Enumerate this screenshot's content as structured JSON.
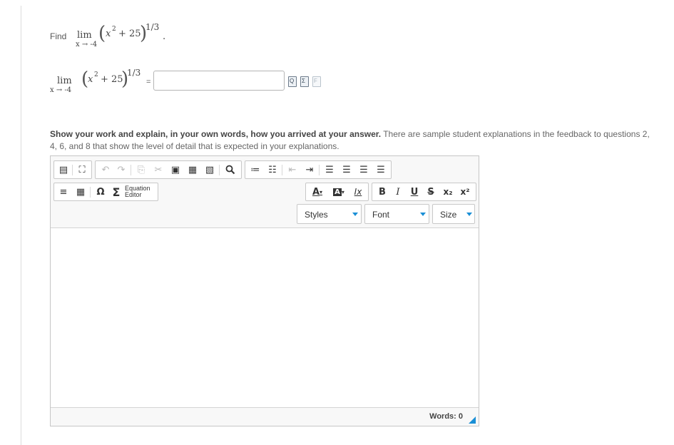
{
  "question": {
    "find_label": "Find",
    "lim_label": "lim",
    "lim_sub": "x → -4",
    "expr": "x",
    "expr_power": "2",
    "expr_tail": "+ 25",
    "outer_exponent": "1/3",
    "period": ".",
    "equals": "="
  },
  "answer": {
    "value": "",
    "placeholder": ""
  },
  "answer_tools": [
    {
      "icon": "preview-icon",
      "glyph": "Q"
    },
    {
      "icon": "sigma-help-icon",
      "glyph": "Σ"
    },
    {
      "icon": "format-help-icon",
      "glyph": "F"
    }
  ],
  "instructions": {
    "bold": "Show your work and explain, in your own words, how you arrived at your answer.",
    "rest": " There are sample student explanations in the feedback to questions 2, 4, 6, and 8 that show the level of detail that is expected in your explanations."
  },
  "editor": {
    "equation_editor_line1": "Equation",
    "equation_editor_line2": "Editor",
    "styles_label": "Styles",
    "font_label": "Font",
    "size_label": "Size",
    "word_count": "Words: 0",
    "toolbar_glyphs": {
      "source": "▤",
      "maximize": "⛶",
      "undo": "↶",
      "redo": "↷",
      "copy": "⎘",
      "cut": "✂",
      "paste": "▣",
      "paste_text": "▦",
      "paste_word": "▧",
      "find": "🔍",
      "ordered_list": "≔",
      "bullet_list": "☷",
      "outdent": "⇤",
      "indent": "⇥",
      "align_left": "☰",
      "align_center": "☰",
      "align_right": "☰",
      "justify": "☰",
      "hr": "≡",
      "table": "▦",
      "omega": "Ω",
      "sigma": "Σ",
      "text_color": "A",
      "bg_color": "A",
      "remove_format": "Ix",
      "bold": "B",
      "italic": "I",
      "underline": "U",
      "strike": "S",
      "subscript": "x₂",
      "superscript": "x²"
    }
  },
  "colors": {
    "accent": "#1a8fd6",
    "border": "#c6c6c6",
    "text": "#555555"
  }
}
